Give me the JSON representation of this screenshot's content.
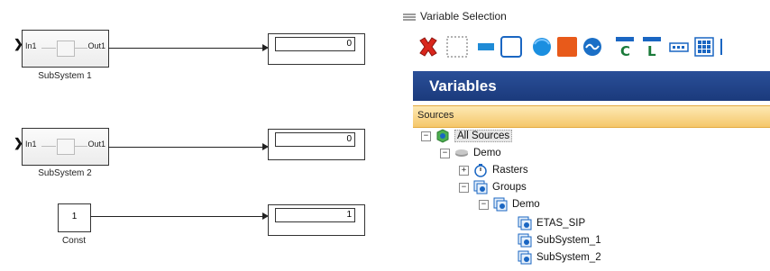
{
  "model": {
    "subsystem1": {
      "in_port": "In1",
      "out_port": "Out1",
      "label": "SubSystem 1"
    },
    "subsystem2": {
      "in_port": "In1",
      "out_port": "Out1",
      "label": "SubSystem 2"
    },
    "const": {
      "value": "1",
      "label": "Const"
    },
    "display1": {
      "value": "0"
    },
    "display2": {
      "value": "0"
    },
    "display3": {
      "value": "1"
    }
  },
  "panel": {
    "title": "Variable Selection",
    "header": "Variables",
    "sources_label": "Sources",
    "tree": {
      "all_sources": "All Sources",
      "demo": "Demo",
      "rasters": "Rasters",
      "groups": "Groups",
      "group_demo": "Demo",
      "etas_sip": "ETAS_SIP",
      "subsystem_1": "SubSystem_1",
      "subsystem_2": "SubSystem_2"
    },
    "colors": {
      "header": "#1f4289",
      "sources": "#f5c76a",
      "delete": "#d9261c"
    }
  }
}
